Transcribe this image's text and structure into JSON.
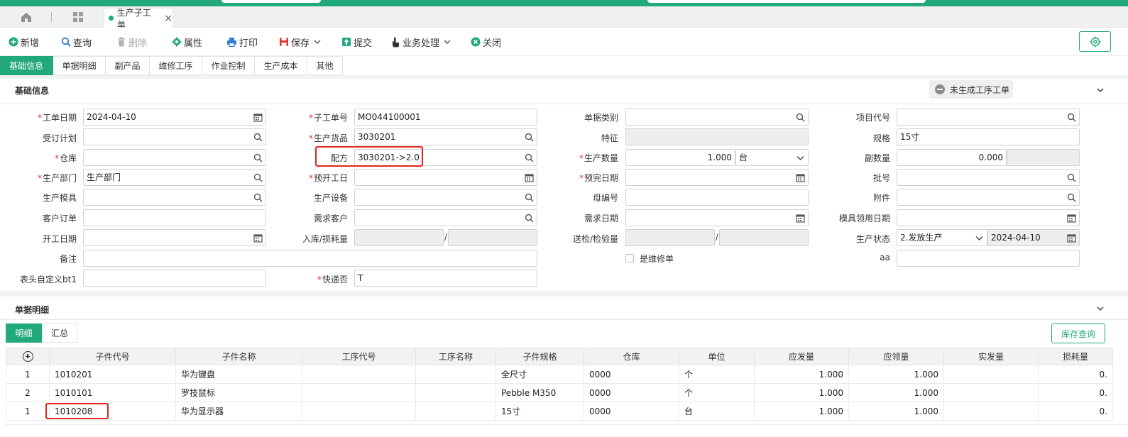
{
  "tabs": {
    "doc_tab_label": "生产子工单",
    "close_glyph": "×"
  },
  "toolbar": {
    "new": "新增",
    "query": "查询",
    "delete": "删除",
    "properties": "属性",
    "print": "打印",
    "save": "保存",
    "submit": "提交",
    "business": "业务处理",
    "close": "关闭"
  },
  "section_tabs": [
    "基础信息",
    "单据明细",
    "副产品",
    "维修工序",
    "作业控制",
    "生产成本",
    "其他"
  ],
  "basic": {
    "title": "基础信息",
    "status_pill": "未生成工序工单"
  },
  "fields": {
    "work_date": {
      "label": "工单日期",
      "value": "2024-04-10"
    },
    "sub_order_no": {
      "label": "子工单号",
      "value": "MO044100001"
    },
    "doc_type": {
      "label": "单据类别",
      "value": ""
    },
    "project_code": {
      "label": "项目代号",
      "value": ""
    },
    "order_plan": {
      "label": "受订计划",
      "value": ""
    },
    "product_item": {
      "label": "生产货品",
      "value": "3030201"
    },
    "feature": {
      "label": "特征",
      "value": ""
    },
    "spec": {
      "label": "规格",
      "value": "15寸"
    },
    "warehouse": {
      "label": "仓库",
      "value": ""
    },
    "formula": {
      "label": "配方",
      "value": "3030201->2.0"
    },
    "prod_qty": {
      "label": "生产数量",
      "value": "1.000",
      "unit": "台"
    },
    "sub_qty": {
      "label": "副数量",
      "value": "0.000"
    },
    "prod_dept": {
      "label": "生产部门",
      "value": "生产部门"
    },
    "plan_start": {
      "label": "预开工日",
      "value": ""
    },
    "plan_finish": {
      "label": "预完日期",
      "value": ""
    },
    "batch_no": {
      "label": "批号",
      "value": ""
    },
    "prod_mold": {
      "label": "生产模具",
      "value": ""
    },
    "prod_equip": {
      "label": "生产设备",
      "value": ""
    },
    "parent_no": {
      "label": "母编号",
      "value": ""
    },
    "attachment": {
      "label": "附件",
      "value": ""
    },
    "customer_order": {
      "label": "客户订单",
      "value": ""
    },
    "demand_customer": {
      "label": "需求客户",
      "value": ""
    },
    "demand_date": {
      "label": "需求日期",
      "value": ""
    },
    "mold_use_date": {
      "label": "模具领用日期",
      "value": ""
    },
    "start_date": {
      "label": "开工日期",
      "value": ""
    },
    "in_loss_qty": {
      "label": "入库/损耗量",
      "value": ""
    },
    "inspect_qty": {
      "label": "送检/检验量",
      "value": ""
    },
    "prod_status": {
      "label": "生产状态",
      "value": "2.发放生产",
      "date": "2024-04-10"
    },
    "remark": {
      "label": "备注",
      "value": ""
    },
    "is_repair": {
      "label": "是维修单"
    },
    "aa": {
      "label": "aa",
      "value": ""
    },
    "header_bt1": {
      "label": "表头自定义bt1",
      "value": ""
    },
    "express": {
      "label": "快递否",
      "value": "T"
    },
    "slash": "/"
  },
  "detail": {
    "title": "单据明细",
    "subtabs": [
      "明细",
      "汇总"
    ],
    "stock_query": "库存查询",
    "columns": [
      "子件代号",
      "子件名称",
      "工序代号",
      "工序名称",
      "子件规格",
      "仓库",
      "单位",
      "应发量",
      "应领量",
      "实发量",
      "损耗量"
    ],
    "rows": [
      [
        "1",
        "1010201",
        "华为键盘",
        "",
        "",
        "全尺寸",
        "0000",
        "个",
        "1.000",
        "1.000",
        "",
        "0."
      ],
      [
        "2",
        "1010101",
        "罗技鼠标",
        "",
        "",
        "Pebble M350",
        "0000",
        "个",
        "1.000",
        "1.000",
        "",
        "0."
      ],
      [
        "1",
        "1010208",
        "华为显示器",
        "",
        "",
        "15寸",
        "0000",
        "台",
        "1.000",
        "1.000",
        "",
        "0."
      ]
    ]
  },
  "colors": {
    "accent": "#21a87c",
    "highlight": "#e3261e",
    "required": "#e0352b"
  }
}
